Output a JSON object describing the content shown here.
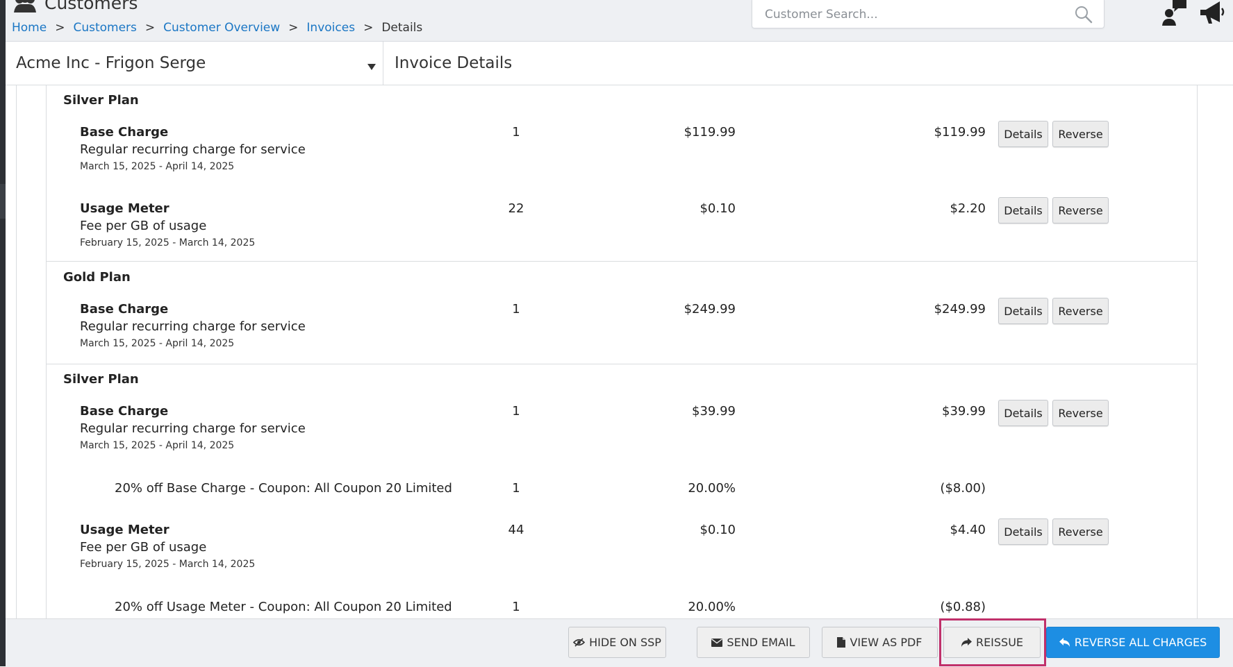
{
  "header": {
    "title": "Customers",
    "breadcrumb": [
      "Home",
      "Customers",
      "Customer Overview",
      "Invoices",
      "Details"
    ],
    "breadcrumb_sep": ">",
    "search_placeholder": "Customer Search..."
  },
  "subheader": {
    "customer": "Acme Inc - Frigon Serge",
    "section_title": "Invoice Details"
  },
  "invoice": {
    "groups": [
      {
        "title": "Silver Plan",
        "rows": [
          {
            "name": "Base Charge",
            "desc": "Regular recurring charge for service",
            "dates": "March 15, 2025 - April 14, 2025",
            "qty": "1",
            "price": "$119.99",
            "total": "$119.99"
          },
          {
            "name": "Usage Meter",
            "desc": "Fee per GB of usage",
            "dates": "February 15, 2025 - March 14, 2025",
            "qty": "22",
            "price": "$0.10",
            "total": "$2.20"
          }
        ]
      },
      {
        "title": "Gold Plan",
        "rows": [
          {
            "name": "Base Charge",
            "desc": "Regular recurring charge for service",
            "dates": "March 15, 2025 - April 14, 2025",
            "qty": "1",
            "price": "$249.99",
            "total": "$249.99"
          }
        ]
      },
      {
        "title": "Silver Plan",
        "rows": [
          {
            "name": "Base Charge",
            "desc": "Regular recurring charge for service",
            "dates": "March 15, 2025 - April 14, 2025",
            "qty": "1",
            "price": "$39.99",
            "total": "$39.99"
          },
          {
            "coupon": "20% off Base Charge - Coupon: All Coupon 20 Limited",
            "qty": "1",
            "price": "20.00%",
            "total": "($8.00)"
          },
          {
            "name": "Usage Meter",
            "desc": "Fee per GB of usage",
            "dates": "February 15, 2025 - March 14, 2025",
            "qty": "44",
            "price": "$0.10",
            "total": "$4.40"
          },
          {
            "coupon": "20% off Usage Meter - Coupon: All Coupon 20 Limited",
            "qty": "1",
            "price": "20.00%",
            "total": "($0.88)"
          }
        ]
      }
    ],
    "row_buttons": {
      "details": "Details",
      "reverse": "Reverse"
    }
  },
  "footer": {
    "hide_on_ssp": "HIDE ON SSP",
    "send_email": "SEND EMAIL",
    "view_as_pdf": "VIEW AS PDF",
    "reissue": "REISSUE",
    "reverse_all": "REVERSE ALL CHARGES"
  },
  "colors": {
    "link": "#1a76c4",
    "primary": "#1d8ee3",
    "highlight": "#c0306a"
  },
  "icons": [
    "users-icon",
    "search-icon",
    "user-chat-icon",
    "megaphone-icon",
    "caret-down-icon",
    "eye-slash-icon",
    "envelope-icon",
    "file-icon",
    "share-icon",
    "undo-icon"
  ]
}
